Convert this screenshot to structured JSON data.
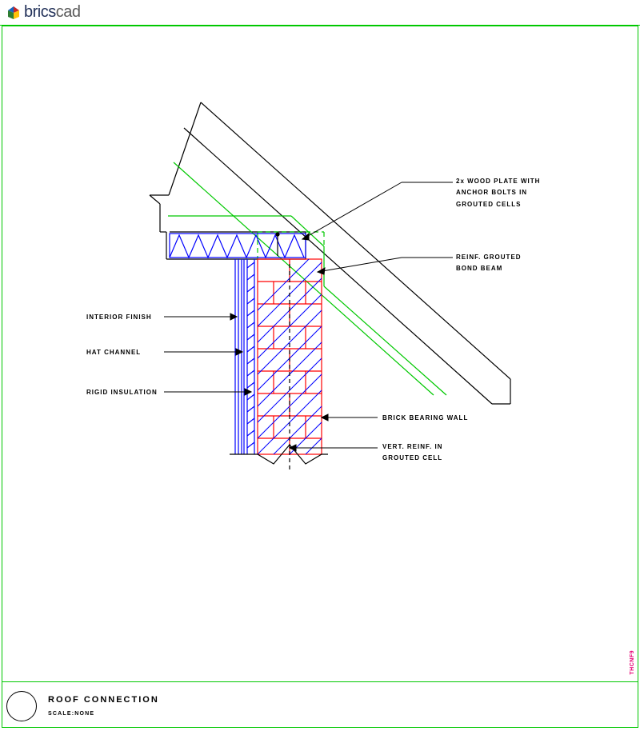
{
  "brand": {
    "prefix": "brics",
    "suffix": "cad"
  },
  "title": {
    "main": "ROOF CONNECTION",
    "scale": "SCALE:NONE"
  },
  "side_tag": "THCNF9",
  "labels": {
    "wood_plate": "2x WOOD PLATE WITH\nANCHOR BOLTS IN\nGROUTED CELLS",
    "bond_beam": "REINF. GROUTED\nBOND BEAM",
    "interior": "INTERIOR FINISH",
    "hat": "HAT CHANNEL",
    "insulation": "RIGID INSULATION",
    "bearing": "BRICK BEARING WALL",
    "vert": "VERT. REINF. IN\nGROUTED CELL"
  }
}
